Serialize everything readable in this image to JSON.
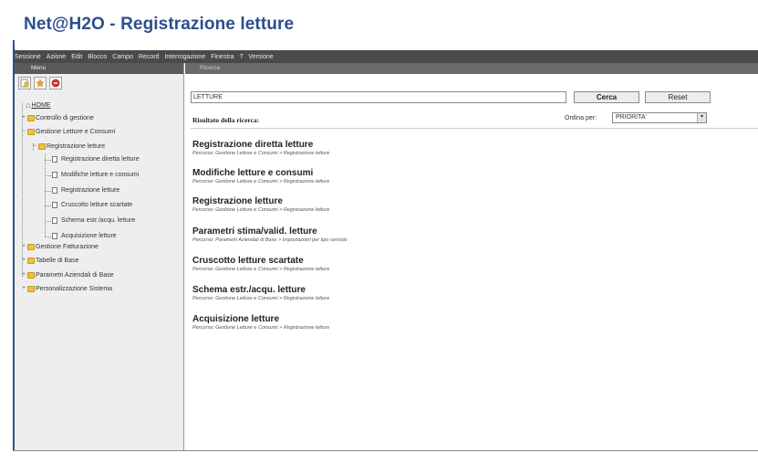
{
  "window": {
    "title": "Net@H2O - Registrazione letture"
  },
  "menubar": {
    "items": [
      "Sessione",
      "Azione",
      "Edit",
      "Blocco",
      "Campo",
      "Record",
      "Interrogazione",
      "Finestra",
      "?",
      "Versione"
    ]
  },
  "sidebar": {
    "header": "Menu",
    "toolbar_icons": [
      "notes-icon",
      "star-icon",
      "stop-icon"
    ],
    "tree": {
      "home": "HOME",
      "controllo": "Controllo di gestione",
      "gestione_letture": "Gestione Letture e Consumi",
      "registrazione_letture_folder": "Registrazione letture",
      "registrazione_diretta": "Registrazione diretta letture",
      "modifiche": "Modifiche letture e consumi",
      "registrazione": "Registrazione letture",
      "cruscotto": "Cruscotto letture scartate",
      "schema": "Schema estr./acqu. letture",
      "acquisizione": "Acquisizione letture",
      "fatturazione": "Gestione Fatturazione",
      "tabelle": "Tabelle di Base",
      "parametri": "Parametri Aziendali di Base",
      "personalizzazione": "Personalizzazione Sistema"
    }
  },
  "main": {
    "header": "Ricerca",
    "search": {
      "value": "LETTURE",
      "search_button": "Cerca",
      "reset_button": "Reset"
    },
    "results_label": "Risultato della ricerca:",
    "sort": {
      "label": "Ordina per:",
      "value": "PRIORITA'"
    },
    "results": [
      {
        "title": "Registrazione diretta letture",
        "path": "Percorso: Gestione Letture e Consumi > Registrazione letture"
      },
      {
        "title": "Modifiche letture e consumi",
        "path": "Percorso: Gestione Letture e Consumi > Registrazione letture"
      },
      {
        "title": "Registrazione letture",
        "path": "Percorso: Gestione Letture e Consumi > Registrazione letture"
      },
      {
        "title": "Parametri stima/valid. letture",
        "path": "Percorso: Parametri Aziendali di Base > Impostazioni per tipo servizio"
      },
      {
        "title": "Cruscotto letture scartate",
        "path": "Percorso: Gestione Letture e Consumi > Registrazione letture"
      },
      {
        "title": "Schema estr./acqu. letture",
        "path": "Percorso: Gestione Letture e Consumi > Registrazione letture"
      },
      {
        "title": "Acquisizione letture",
        "path": "Percorso: Gestione Letture e Consumi > Registrazione letture"
      }
    ]
  },
  "colors": {
    "title": "#2c4f8c",
    "menubar": "#4a4a4a",
    "sidebar_bg": "#eeeeee",
    "folder": "#f0c040"
  }
}
